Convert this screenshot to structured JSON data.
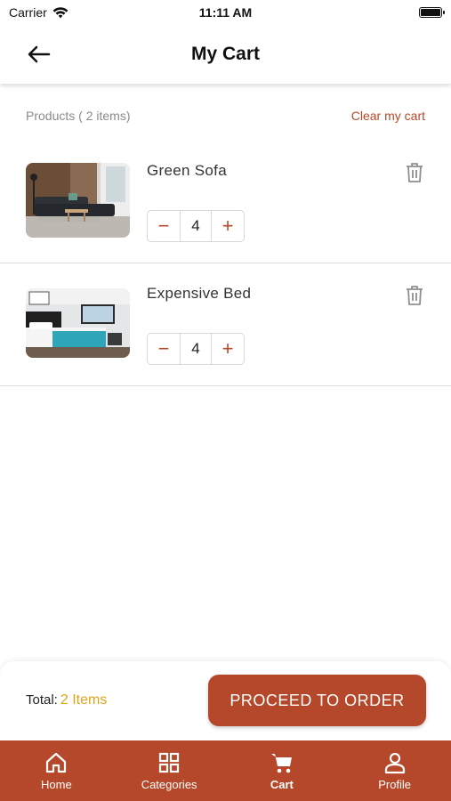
{
  "status_bar": {
    "carrier": "Carrier",
    "time": "11:11 AM"
  },
  "header": {
    "title": "My Cart"
  },
  "summary": {
    "products_label": "Products ( 2 items)",
    "clear_label": "Clear my cart"
  },
  "items": [
    {
      "name": "Green Sofa",
      "quantity": "4",
      "minus": "−",
      "plus": "+"
    },
    {
      "name": "Expensive Bed",
      "quantity": "4",
      "minus": "−",
      "plus": "+"
    }
  ],
  "checkout": {
    "total_label": "Total:",
    "total_count": "2 Items",
    "proceed_label": "PROCEED TO ORDER"
  },
  "tabs": [
    {
      "label": "Home",
      "icon": "home-icon"
    },
    {
      "label": "Categories",
      "icon": "grid-icon"
    },
    {
      "label": "Cart",
      "icon": "cart-icon",
      "active": true
    },
    {
      "label": "Profile",
      "icon": "person-icon"
    }
  ],
  "colors": {
    "accent": "#b5482a",
    "total_highlight": "#e0a21c"
  }
}
